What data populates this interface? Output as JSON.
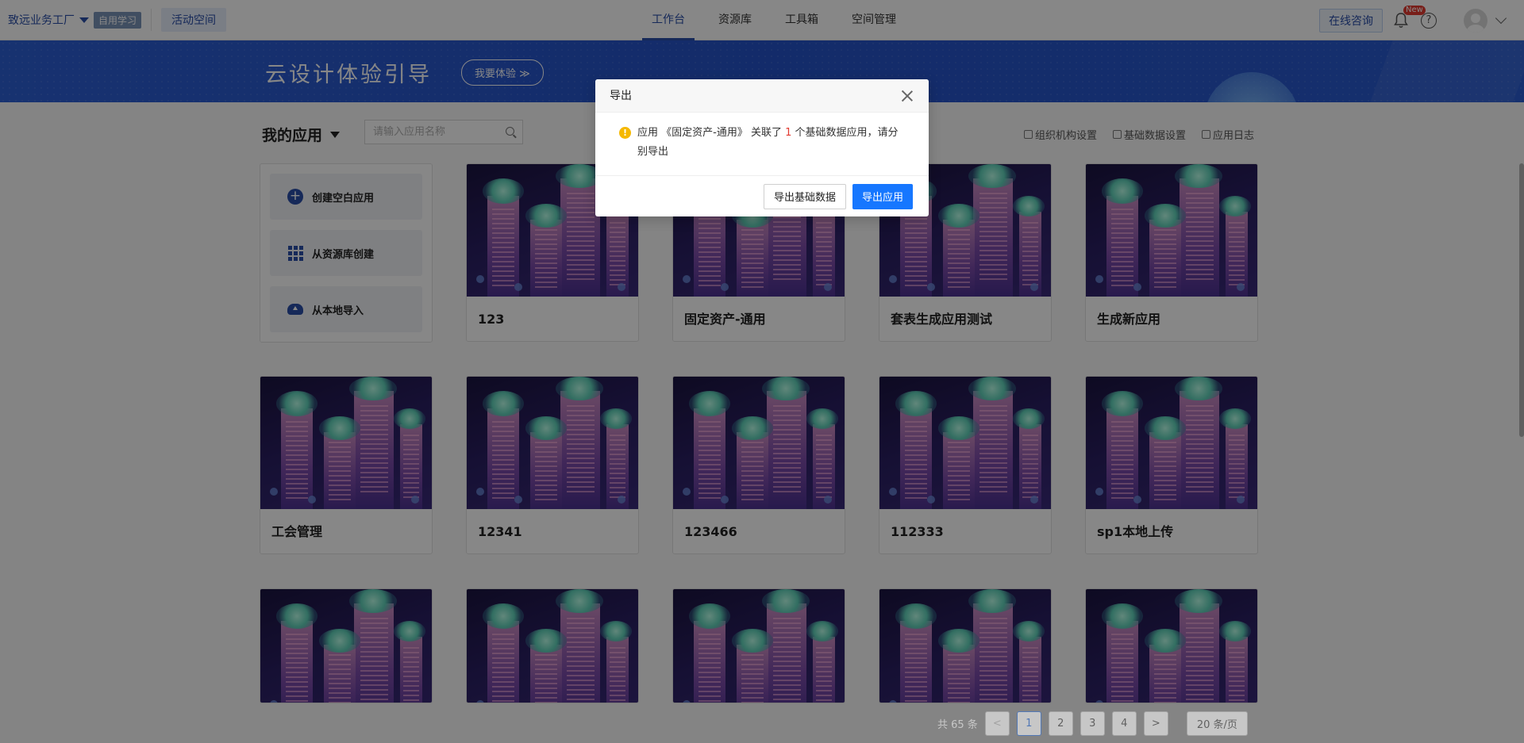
{
  "topbar": {
    "org_name": "致远业务工厂",
    "learn_badge": "自用学习",
    "space_button": "活动空间",
    "nav": [
      {
        "label": "工作台",
        "active": true
      },
      {
        "label": "资源库",
        "active": false
      },
      {
        "label": "工具箱",
        "active": false
      },
      {
        "label": "空间管理",
        "active": false
      }
    ],
    "consult_button": "在线咨询",
    "new_badge": "New",
    "help_glyph": "?"
  },
  "banner": {
    "title": "云设计体验引导",
    "button": "我要体验 ≫"
  },
  "toolbar": {
    "my_apps": "我的应用",
    "search_placeholder": "请输入应用名称",
    "links": [
      "组织机构设置",
      "基础数据设置",
      "应用日志"
    ]
  },
  "create_panel": {
    "blank": "创建空白应用",
    "from_library": "从资源库创建",
    "from_local": "从本地导入",
    "plus_glyph": "+"
  },
  "apps": [
    "123",
    "固定资产-通用",
    "套表生成应用测试",
    "生成新应用",
    "工会管理",
    "12341",
    "123466",
    "112333",
    "sp1本地上传",
    "",
    "",
    "",
    "",
    ""
  ],
  "pagination": {
    "total": "共 65 条",
    "prev": "<",
    "pages": [
      "1",
      "2",
      "3",
      "4"
    ],
    "active_page": "1",
    "next": ">",
    "per_page": "20 条/页"
  },
  "modal": {
    "title": "导出",
    "warn_glyph": "!",
    "message_pre": "应用 《固定资产-通用》 关联了 ",
    "message_count": "1",
    "message_post": " 个基础数据应用，请分别导出",
    "btn_export_base": "导出基础数据",
    "btn_export_app": "导出应用"
  },
  "colors": {
    "brand": "#2a4ea8",
    "primary_button": "#1677ff",
    "warning": "#f5b800",
    "count_red": "#e23a30"
  }
}
